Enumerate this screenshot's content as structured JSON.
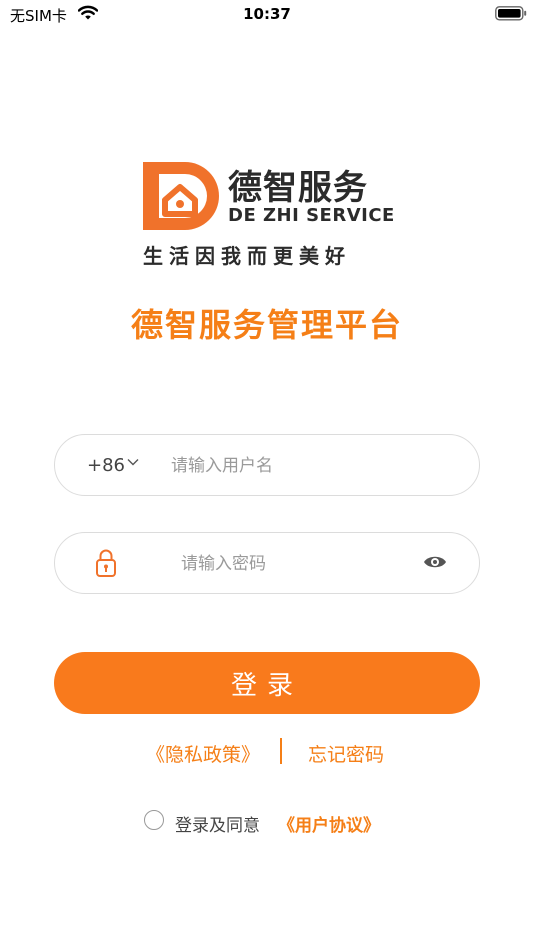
{
  "status_bar": {
    "carrier": "无SIM卡",
    "time": "10:37",
    "wifi_icon": "wifi-icon",
    "battery_icon": "battery-icon"
  },
  "brand": {
    "name_cn": "德智服务",
    "name_en": "DE ZHI SERVICE",
    "slogan": "生活因我而更美好",
    "platform_title": "德智服务管理平台",
    "logo_icon": "house-d-logo-icon"
  },
  "form": {
    "country_code": "+86",
    "username_placeholder": "请输入用户名",
    "password_placeholder": "请输入密码",
    "login_label": "登录"
  },
  "links": {
    "privacy": "《隐私政策》",
    "forgot_password": "忘记密码"
  },
  "agreement": {
    "text": "登录及同意",
    "link": "《用户协议》"
  },
  "colors": {
    "accent": "#F97A1C",
    "text_dark": "#2B2B2B",
    "placeholder": "#9A9A9A",
    "border": "#DCDCDC"
  }
}
